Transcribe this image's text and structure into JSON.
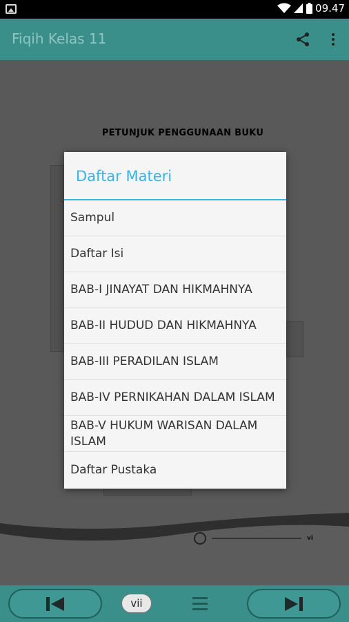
{
  "status_bar": {
    "time": "09.47",
    "icons": [
      "image-icon",
      "wifi-icon",
      "signal-icon",
      "battery-icon"
    ]
  },
  "app_bar": {
    "title": "Fiqih Kelas 11",
    "actions": [
      "share-icon",
      "more-vert-icon"
    ]
  },
  "page": {
    "heading": "PETUNJUK PENGGUNAAN BUKU",
    "page_number": "vi"
  },
  "dialog": {
    "title": "Daftar Materi",
    "items": [
      {
        "label": "Sampul"
      },
      {
        "label": "Daftar Isi"
      },
      {
        "label": "BAB-I JINAYAT DAN HIKMAHNYA"
      },
      {
        "label": "BAB-II HUDUD DAN HIKMAHNYA"
      },
      {
        "label": "BAB-III PERADILAN ISLAM"
      },
      {
        "label": "BAB-IV PERNIKAHAN DALAM ISLAM"
      },
      {
        "label": "BAB-V HUKUM WARISAN DALAM ISLAM"
      },
      {
        "label": "Daftar Pustaka"
      }
    ]
  },
  "bottom_bar": {
    "page_label": "vii",
    "icons": [
      "skip-previous-icon",
      "menu-icon",
      "skip-next-icon"
    ]
  },
  "colors": {
    "app_bar": "#3a8f8a",
    "dialog_accent": "#33b5e5"
  }
}
